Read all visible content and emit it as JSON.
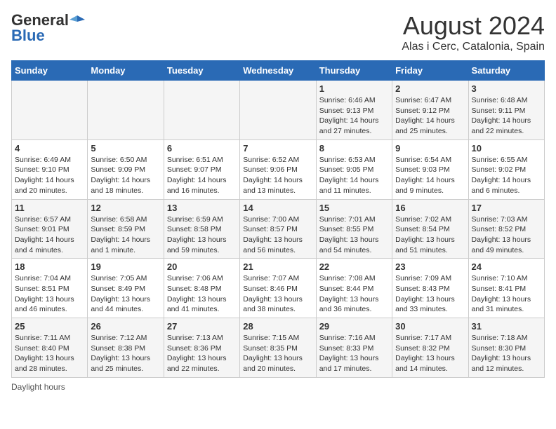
{
  "header": {
    "logo_general": "General",
    "logo_blue": "Blue",
    "month": "August 2024",
    "location": "Alas i Cerc, Catalonia, Spain"
  },
  "days_of_week": [
    "Sunday",
    "Monday",
    "Tuesday",
    "Wednesday",
    "Thursday",
    "Friday",
    "Saturday"
  ],
  "weeks": [
    [
      {
        "day": "",
        "info": ""
      },
      {
        "day": "",
        "info": ""
      },
      {
        "day": "",
        "info": ""
      },
      {
        "day": "",
        "info": ""
      },
      {
        "day": "1",
        "info": "Sunrise: 6:46 AM\nSunset: 9:13 PM\nDaylight: 14 hours and 27 minutes."
      },
      {
        "day": "2",
        "info": "Sunrise: 6:47 AM\nSunset: 9:12 PM\nDaylight: 14 hours and 25 minutes."
      },
      {
        "day": "3",
        "info": "Sunrise: 6:48 AM\nSunset: 9:11 PM\nDaylight: 14 hours and 22 minutes."
      }
    ],
    [
      {
        "day": "4",
        "info": "Sunrise: 6:49 AM\nSunset: 9:10 PM\nDaylight: 14 hours and 20 minutes."
      },
      {
        "day": "5",
        "info": "Sunrise: 6:50 AM\nSunset: 9:09 PM\nDaylight: 14 hours and 18 minutes."
      },
      {
        "day": "6",
        "info": "Sunrise: 6:51 AM\nSunset: 9:07 PM\nDaylight: 14 hours and 16 minutes."
      },
      {
        "day": "7",
        "info": "Sunrise: 6:52 AM\nSunset: 9:06 PM\nDaylight: 14 hours and 13 minutes."
      },
      {
        "day": "8",
        "info": "Sunrise: 6:53 AM\nSunset: 9:05 PM\nDaylight: 14 hours and 11 minutes."
      },
      {
        "day": "9",
        "info": "Sunrise: 6:54 AM\nSunset: 9:03 PM\nDaylight: 14 hours and 9 minutes."
      },
      {
        "day": "10",
        "info": "Sunrise: 6:55 AM\nSunset: 9:02 PM\nDaylight: 14 hours and 6 minutes."
      }
    ],
    [
      {
        "day": "11",
        "info": "Sunrise: 6:57 AM\nSunset: 9:01 PM\nDaylight: 14 hours and 4 minutes."
      },
      {
        "day": "12",
        "info": "Sunrise: 6:58 AM\nSunset: 8:59 PM\nDaylight: 14 hours and 1 minute."
      },
      {
        "day": "13",
        "info": "Sunrise: 6:59 AM\nSunset: 8:58 PM\nDaylight: 13 hours and 59 minutes."
      },
      {
        "day": "14",
        "info": "Sunrise: 7:00 AM\nSunset: 8:57 PM\nDaylight: 13 hours and 56 minutes."
      },
      {
        "day": "15",
        "info": "Sunrise: 7:01 AM\nSunset: 8:55 PM\nDaylight: 13 hours and 54 minutes."
      },
      {
        "day": "16",
        "info": "Sunrise: 7:02 AM\nSunset: 8:54 PM\nDaylight: 13 hours and 51 minutes."
      },
      {
        "day": "17",
        "info": "Sunrise: 7:03 AM\nSunset: 8:52 PM\nDaylight: 13 hours and 49 minutes."
      }
    ],
    [
      {
        "day": "18",
        "info": "Sunrise: 7:04 AM\nSunset: 8:51 PM\nDaylight: 13 hours and 46 minutes."
      },
      {
        "day": "19",
        "info": "Sunrise: 7:05 AM\nSunset: 8:49 PM\nDaylight: 13 hours and 44 minutes."
      },
      {
        "day": "20",
        "info": "Sunrise: 7:06 AM\nSunset: 8:48 PM\nDaylight: 13 hours and 41 minutes."
      },
      {
        "day": "21",
        "info": "Sunrise: 7:07 AM\nSunset: 8:46 PM\nDaylight: 13 hours and 38 minutes."
      },
      {
        "day": "22",
        "info": "Sunrise: 7:08 AM\nSunset: 8:44 PM\nDaylight: 13 hours and 36 minutes."
      },
      {
        "day": "23",
        "info": "Sunrise: 7:09 AM\nSunset: 8:43 PM\nDaylight: 13 hours and 33 minutes."
      },
      {
        "day": "24",
        "info": "Sunrise: 7:10 AM\nSunset: 8:41 PM\nDaylight: 13 hours and 31 minutes."
      }
    ],
    [
      {
        "day": "25",
        "info": "Sunrise: 7:11 AM\nSunset: 8:40 PM\nDaylight: 13 hours and 28 minutes."
      },
      {
        "day": "26",
        "info": "Sunrise: 7:12 AM\nSunset: 8:38 PM\nDaylight: 13 hours and 25 minutes."
      },
      {
        "day": "27",
        "info": "Sunrise: 7:13 AM\nSunset: 8:36 PM\nDaylight: 13 hours and 22 minutes."
      },
      {
        "day": "28",
        "info": "Sunrise: 7:15 AM\nSunset: 8:35 PM\nDaylight: 13 hours and 20 minutes."
      },
      {
        "day": "29",
        "info": "Sunrise: 7:16 AM\nSunset: 8:33 PM\nDaylight: 13 hours and 17 minutes."
      },
      {
        "day": "30",
        "info": "Sunrise: 7:17 AM\nSunset: 8:32 PM\nDaylight: 13 hours and 14 minutes."
      },
      {
        "day": "31",
        "info": "Sunrise: 7:18 AM\nSunset: 8:30 PM\nDaylight: 13 hours and 12 minutes."
      }
    ]
  ],
  "footer": {
    "daylight_label": "Daylight hours"
  }
}
